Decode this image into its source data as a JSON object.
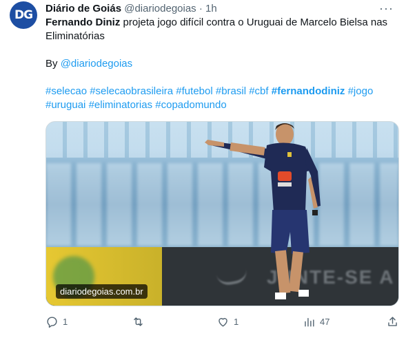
{
  "author": {
    "avatar_text": "DG",
    "name": "Diário de Goiás",
    "handle": "@diariodegoias",
    "separator": "·",
    "time": "1h"
  },
  "more_label": "···",
  "tweet": {
    "headline_bold": "Fernando Diniz",
    "headline_rest": " projeta jogo difícil contra o Uruguai de Marcelo Bielsa nas Eliminatórias",
    "by_prefix": "By ",
    "by_mention": "@diariodegoias",
    "hashtags_line1": [
      "#selecao",
      "#selecaobrasileira",
      "#futebol",
      "#brasil",
      "#cbf",
      "#fernandodiniz",
      "#jogo"
    ],
    "hashtags_line2": [
      "#uruguai",
      "#eliminatorias",
      "#copadomundo"
    ]
  },
  "media": {
    "watermark": "diariodegoias.com.br",
    "ad_text": "JUNTE-SE A NÓS"
  },
  "actions": {
    "replies": "1",
    "retweets": "",
    "likes": "1",
    "views": "47"
  },
  "colors": {
    "link": "#1d9bf0",
    "muted": "#536471",
    "text": "#0f1419",
    "avatar": "#1d4ea3"
  },
  "icons": [
    "reply-icon",
    "retweet-icon",
    "like-icon",
    "views-icon",
    "share-icon",
    "more-icon"
  ]
}
